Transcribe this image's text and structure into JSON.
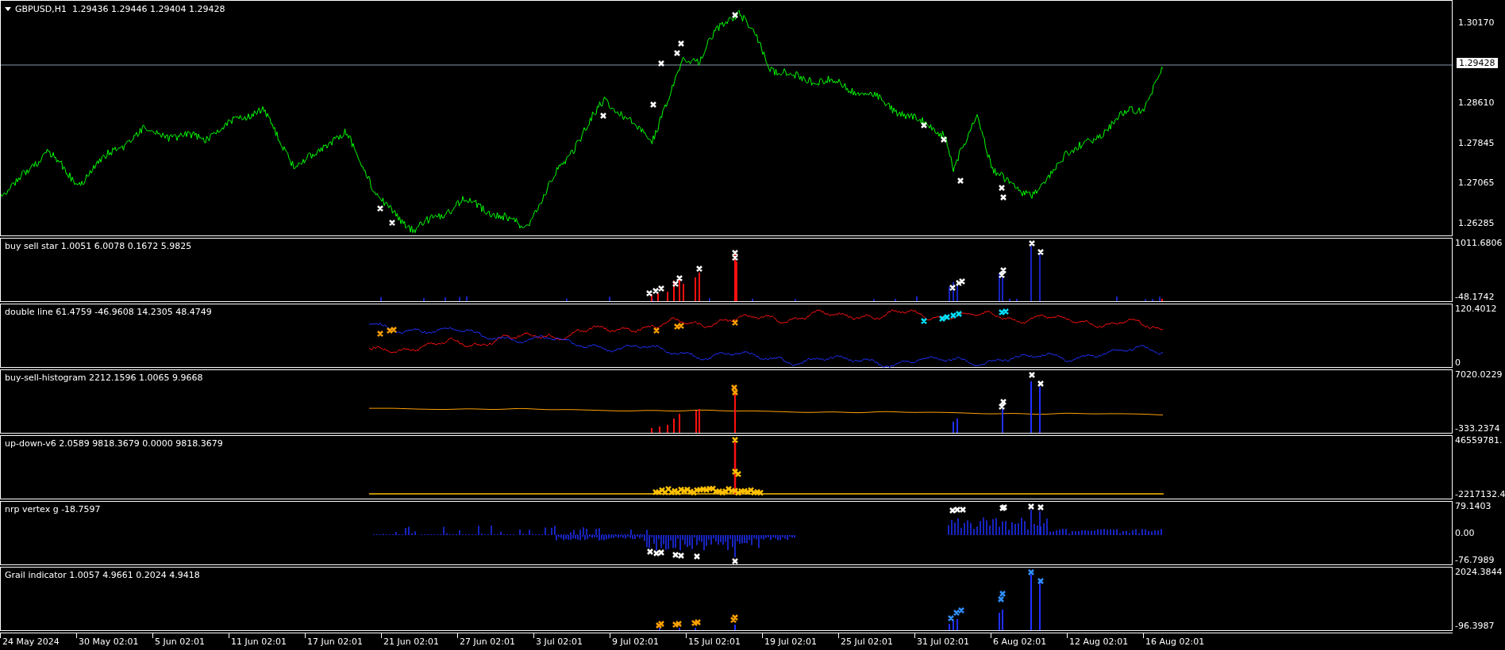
{
  "chart": {
    "title": "GBPUSD,H1  1.29436 1.29446 1.29404 1.29428",
    "price_axis": [
      {
        "label": "1.30170",
        "kind": "tick"
      },
      {
        "label": "1.29428",
        "kind": "price_tag"
      },
      {
        "label": "1.28610",
        "kind": "tick"
      },
      {
        "label": "1.27845",
        "kind": "tick"
      },
      {
        "label": "1.27065",
        "kind": "tick"
      },
      {
        "label": "1.26285",
        "kind": "tick"
      }
    ]
  },
  "indicators": [
    {
      "kind": "star",
      "label": "buy sell star 1.0051 6.0078 0.1672 5.9825",
      "axis": [
        "1011.6806",
        "-48.1742"
      ]
    },
    {
      "kind": "lines",
      "label": "double line 61.4759 -46.9608 14.2305 48.4749",
      "axis": [
        "120.4012",
        "0"
      ]
    },
    {
      "kind": "histogram",
      "label": "buy-sell-histogram 2212.1596 1.0065 9.9668",
      "axis": [
        "7020.0229",
        "-333.2374"
      ]
    },
    {
      "kind": "updown",
      "label": "up-down-v6 2.0589 9818.3679 0.0000 9818.3679",
      "axis": [
        "46559781.",
        "-2217132.4"
      ]
    },
    {
      "kind": "vertex",
      "label": "nrp vertex g -18.7597",
      "axis": [
        "79.1403",
        "0.00",
        "-76.7989"
      ]
    },
    {
      "kind": "grail",
      "label": "Grail indicator 1.0057 4.9661 0.2024 4.9418",
      "axis": [
        "2024.3844",
        "-96.3987"
      ]
    }
  ],
  "time_axis": [
    "24 May 2024",
    "30 May 02:01",
    "5 Jun 02:01",
    "11 Jun 02:01",
    "17 Jun 02:01",
    "21 Jun 02:01",
    "27 Jun 02:01",
    "3 Jul 02:01",
    "9 Jul 02:01",
    "15 Jul 02:01",
    "19 Jul 02:01",
    "25 Jul 02:01",
    "31 Jul 02:01",
    "6 Aug 02:01",
    "12 Aug 02:01",
    "16 Aug 02:01"
  ]
}
